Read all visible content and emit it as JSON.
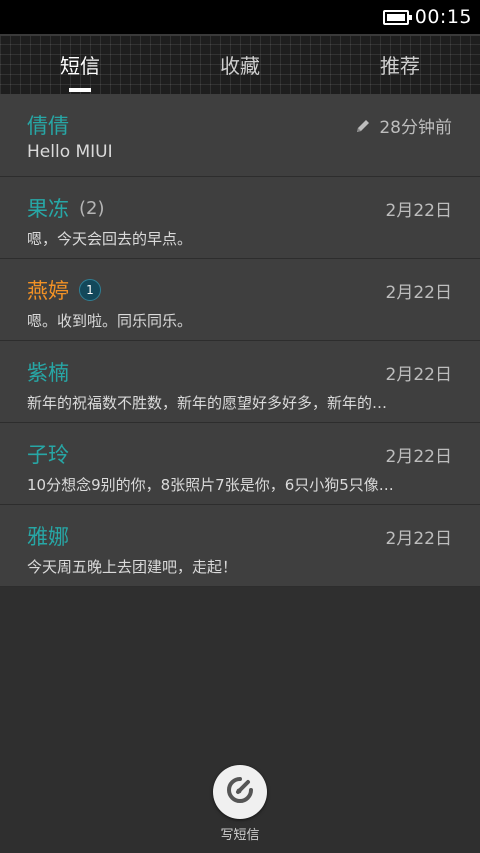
{
  "status_bar": {
    "time": "00:15",
    "battery_icon": "battery-full-icon"
  },
  "tabs": [
    {
      "label": "短信",
      "active": true
    },
    {
      "label": "收藏",
      "active": false
    },
    {
      "label": "推荐",
      "active": false
    }
  ],
  "conversations": [
    {
      "name": "倩倩",
      "count": "",
      "unread_badge": "",
      "time": "28分钟前",
      "draft": true,
      "preview": "Hello MIUI"
    },
    {
      "name": "果冻",
      "count": "(2)",
      "unread_badge": "",
      "time": "2月22日",
      "draft": false,
      "preview": "嗯，今天会回去的早点。"
    },
    {
      "name": "燕婷",
      "count": "",
      "unread_badge": "1",
      "time": "2月22日",
      "draft": false,
      "preview": "嗯。收到啦。同乐同乐。"
    },
    {
      "name": "紫楠",
      "count": "",
      "unread_badge": "",
      "time": "2月22日",
      "draft": false,
      "preview": "新年的祝福数不胜数，新年的愿望好多好多，新年的…"
    },
    {
      "name": "子玲",
      "count": "",
      "unread_badge": "",
      "time": "2月22日",
      "draft": false,
      "preview": "10分想念9别的你，8张照片7张是你，6只小狗5只像…"
    },
    {
      "name": "雅娜",
      "count": "",
      "unread_badge": "",
      "time": "2月22日",
      "draft": false,
      "preview": "今天周五晚上去团建吧，走起！"
    }
  ],
  "compose": {
    "label": "写短信",
    "icon": "compose-icon"
  },
  "colors": {
    "name": "#27a7a6",
    "unread_name": "#f29125",
    "list_bg": "#3f3f3f",
    "page_bg": "#2f2f2f"
  }
}
